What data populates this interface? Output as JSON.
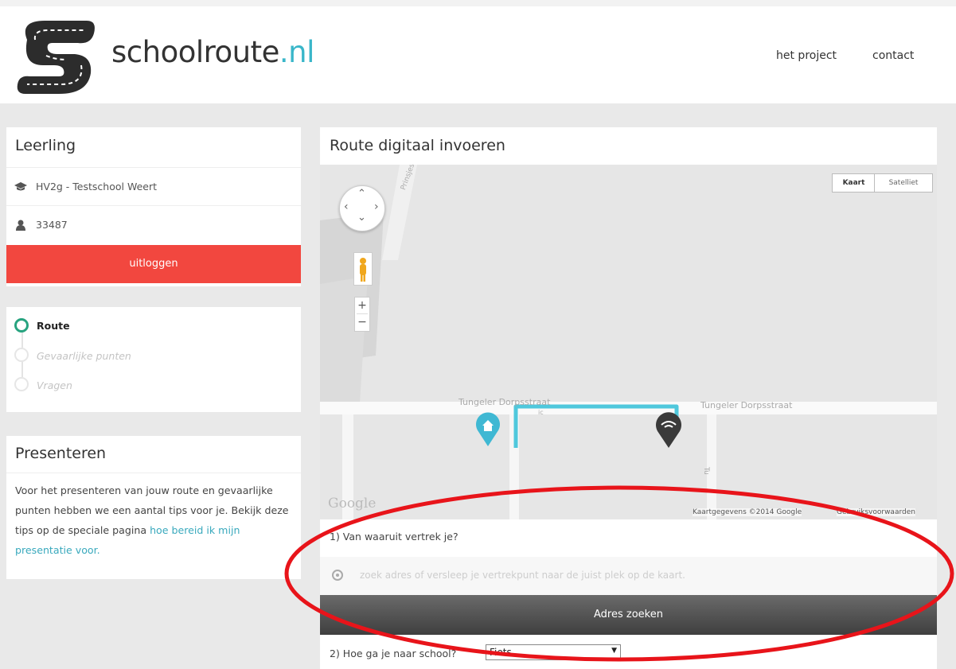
{
  "header": {
    "brand_name": "schoolroute",
    "brand_tld": ".nl",
    "nav": [
      "het project",
      "contact"
    ]
  },
  "student_panel": {
    "title": "Leerling",
    "class_school": "HV2g - Testschool Weert",
    "student_number": "33487",
    "logout_label": "uitloggen",
    "icons": [
      "graduation-cap-icon",
      "user-icon"
    ]
  },
  "steps": {
    "items": [
      {
        "label": "Route",
        "active": true
      },
      {
        "label": "Gevaarlijke punten",
        "active": false
      },
      {
        "label": "Vragen",
        "active": false
      }
    ]
  },
  "present_panel": {
    "title": "Presenteren",
    "text": "Voor het presenteren van jouw route en gevaarlijke punten hebben we een aantal tips voor je. Bekijk deze tips op de speciale pagina",
    "link": "hoe bereid ik mijn presentatie voor."
  },
  "route_panel": {
    "title": "Route digitaal invoeren",
    "map": {
      "type_buttons": [
        "Kaart",
        "Satelliet"
      ],
      "street_top": "Prinsjesstraat",
      "street_left": "Tungeler Dorpsstraat",
      "street_right": "Tungeler Dorpsstraat",
      "street_vertical": "Tu",
      "shop_label": "ic",
      "google_logo": "Google",
      "attribution": "Kaartgegevens ©2014 Google",
      "terms": "Gebruiksvoorwaarden",
      "zoom_in": "+",
      "zoom_out": "−"
    },
    "question1": "1) Van waaruit vertrek je?",
    "search_placeholder": "zoek adres of versleep je vertrekpunt naar de juist plek op de kaart.",
    "search_button": "Adres zoeken",
    "question2": "2) Hoe ga je naar school?",
    "transport_selected": "Fiets"
  },
  "colors": {
    "accent": "#39b6c9",
    "logout": "#f2473f",
    "step_active": "#27a37f",
    "route_line": "#4fc8dc",
    "highlight_oval": "#e8141a"
  }
}
